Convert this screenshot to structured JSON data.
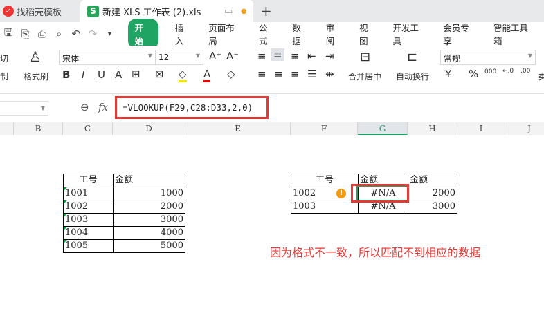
{
  "tabs": [
    {
      "label": "找稻壳模板"
    },
    {
      "label": "新建 XLS 工作表 (2).xls"
    }
  ],
  "new_tab": "+",
  "menu": [
    "开始",
    "插入",
    "页面布局",
    "公式",
    "数据",
    "审阅",
    "视图",
    "开发工具",
    "会员专享",
    "智能工具箱"
  ],
  "ribbon": {
    "cut": "剪切",
    "copy": "复制",
    "format_painter": "格式刷",
    "font": "宋体",
    "size": "12",
    "merge": "合并居中",
    "wrap": "自动换行",
    "number_format": "常规",
    "currency": "¥",
    "percent": "%",
    "thousands": "000",
    "type_partial": "类"
  },
  "formula_bar": {
    "fx": "fx",
    "formula": "=VLOOKUP(F29,C28:D33,2,0)"
  },
  "columns": [
    "B",
    "C",
    "D",
    "E",
    "F",
    "G",
    "H",
    "I",
    "J"
  ],
  "left_table": {
    "headers": [
      "工号",
      "金额"
    ],
    "rows": [
      [
        "1001",
        "1000"
      ],
      [
        "1002",
        "2000"
      ],
      [
        "1003",
        "3000"
      ],
      [
        "1004",
        "4000"
      ],
      [
        "1005",
        "5000"
      ]
    ]
  },
  "right_table": {
    "headers": [
      "工号",
      "金额",
      "金额"
    ],
    "rows": [
      [
        "1002",
        "#N/A",
        "2000"
      ],
      [
        "1003",
        "#N/A",
        "3000"
      ]
    ]
  },
  "note": "因为格式不一致，所以匹配不到相应的数据",
  "colors": {
    "accent": "#1fa463",
    "highlight": "#e53935"
  }
}
